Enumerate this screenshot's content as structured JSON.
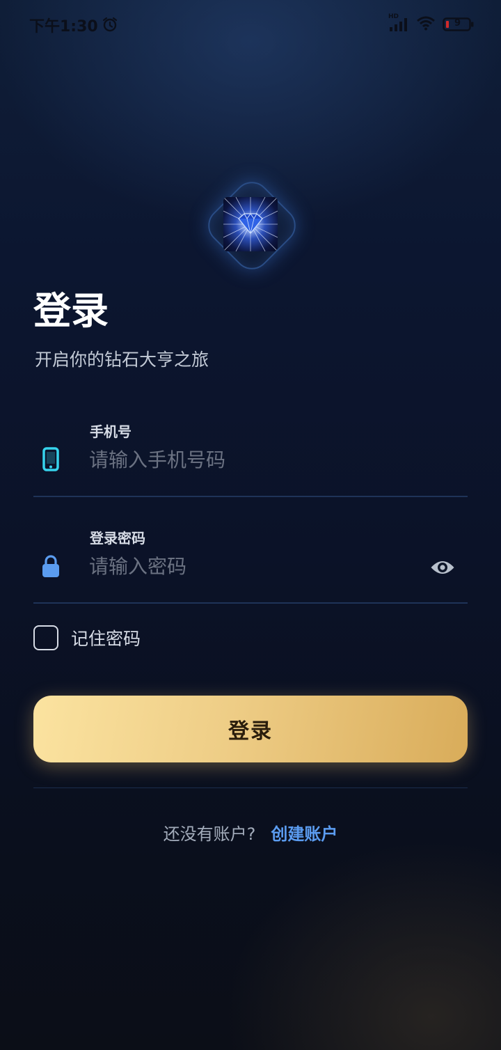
{
  "status_bar": {
    "time": "下午1:30",
    "network_label": "HD",
    "battery_level": "9"
  },
  "icons": {
    "alarm": "alarm-clock-icon",
    "signal": "signal-bars-icon",
    "wifi": "wifi-icon",
    "battery": "battery-icon",
    "phone": "mobile-phone-icon",
    "lock": "lock-icon",
    "eye": "eye-icon",
    "logo": "diamond-logo-icon"
  },
  "header": {
    "title": "登录",
    "subtitle": "开启你的钻石大亨之旅"
  },
  "phone_field": {
    "label": "手机号",
    "placeholder": "请输入手机号码",
    "value": ""
  },
  "password_field": {
    "label": "登录密码",
    "placeholder": "请输入密码",
    "value": ""
  },
  "remember": {
    "label": "记住密码",
    "checked": false
  },
  "login_button": {
    "label": "登录"
  },
  "signup": {
    "prompt": "还没有账户?",
    "link": "创建账户"
  },
  "colors": {
    "accent_gold_start": "#fbe3a0",
    "accent_gold_end": "#d9ac5a",
    "link_blue": "#5b9cf0",
    "phone_icon_cyan": "#36d3ec",
    "lock_icon_blue": "#5b9cf0",
    "background_top": "#0f1e38",
    "background_bottom": "#0b0e17"
  }
}
